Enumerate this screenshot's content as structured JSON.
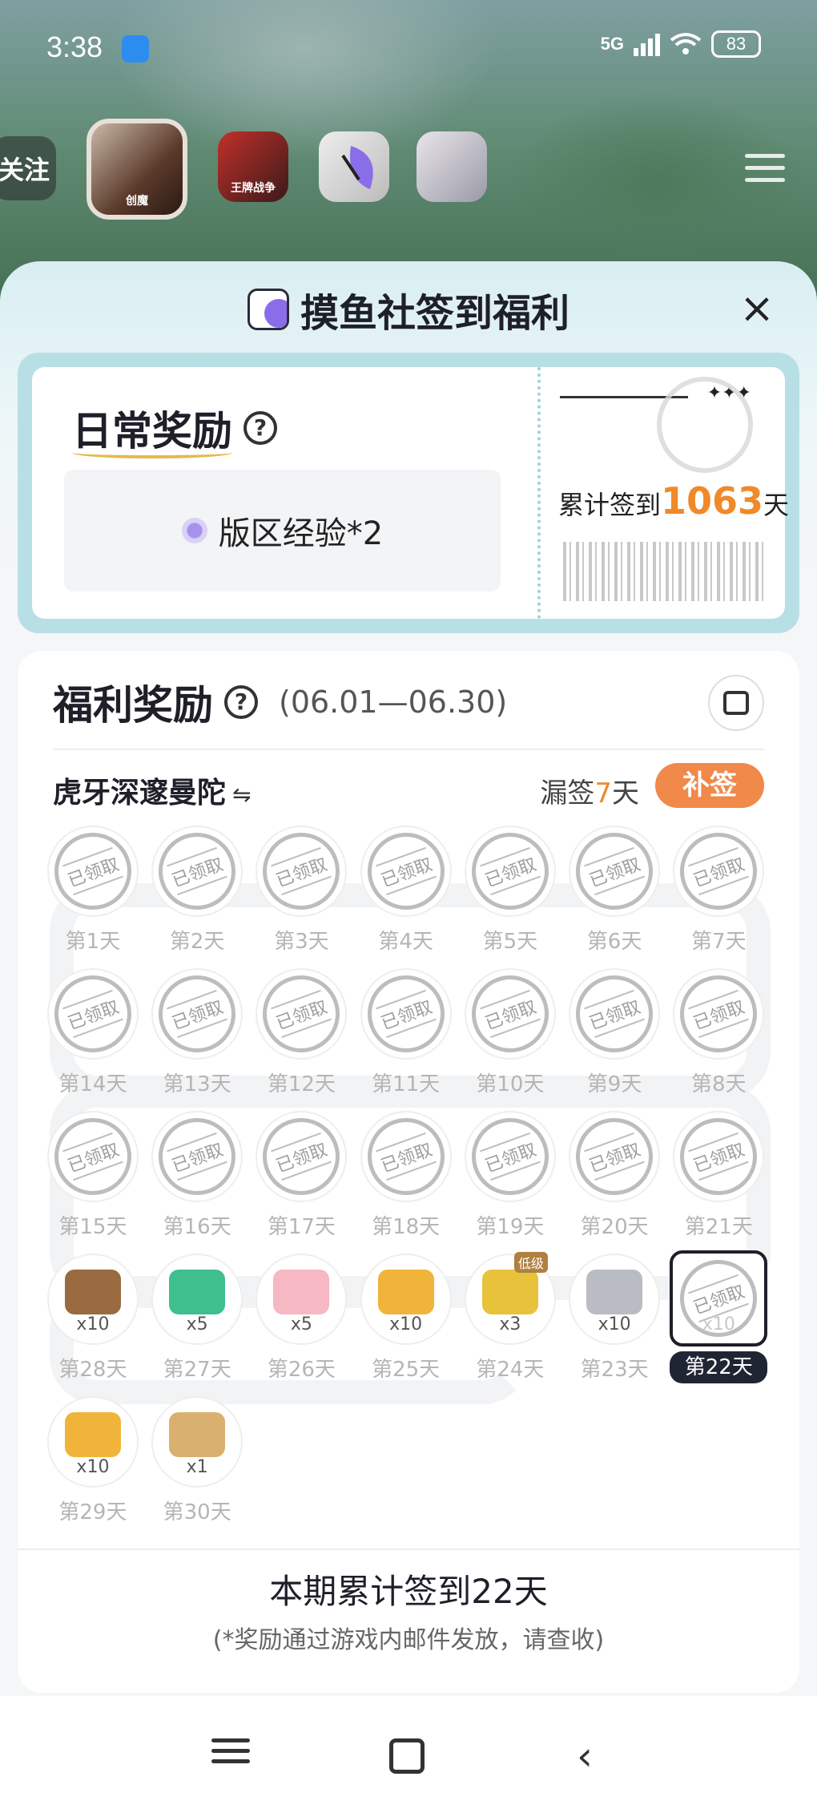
{
  "status": {
    "time": "3:38",
    "network": "5G",
    "battery": "83"
  },
  "topnav": {
    "follow_label": "关注",
    "tiles": [
      {
        "name": "创魔",
        "active": true
      },
      {
        "name": "王牌战争",
        "active": false
      },
      {
        "name": "摸鱼社",
        "active": false
      },
      {
        "name": "",
        "active": false
      }
    ]
  },
  "sheet": {
    "title": "摸鱼社签到福利",
    "close": "×"
  },
  "ticket": {
    "daily_title": "日常奖励",
    "daily_reward": "版区经验*2",
    "cumulative_prefix": "累计签到",
    "cumulative_days": "1063",
    "cumulative_suffix": "天",
    "stars": "✦✦✦"
  },
  "welfare": {
    "title": "福利奖励",
    "range": "(06.01—06.30)",
    "item_name": "虎牙深邃曼陀",
    "swap": "⇋",
    "missed_prefix": "漏签",
    "missed_days": "7",
    "missed_suffix": "天",
    "makeup_label": "补签",
    "claimed_text": "已领取",
    "days": [
      {
        "label": "第1天",
        "state": "claimed"
      },
      {
        "label": "第2天",
        "state": "claimed"
      },
      {
        "label": "第3天",
        "state": "claimed"
      },
      {
        "label": "第4天",
        "state": "claimed"
      },
      {
        "label": "第5天",
        "state": "claimed"
      },
      {
        "label": "第6天",
        "state": "claimed"
      },
      {
        "label": "第7天",
        "state": "claimed"
      },
      {
        "label": "第8天",
        "state": "claimed"
      },
      {
        "label": "第9天",
        "state": "claimed"
      },
      {
        "label": "第10天",
        "state": "claimed"
      },
      {
        "label": "第11天",
        "state": "claimed"
      },
      {
        "label": "第12天",
        "state": "claimed"
      },
      {
        "label": "第13天",
        "state": "claimed"
      },
      {
        "label": "第14天",
        "state": "claimed"
      },
      {
        "label": "第15天",
        "state": "claimed"
      },
      {
        "label": "第16天",
        "state": "claimed"
      },
      {
        "label": "第17天",
        "state": "claimed"
      },
      {
        "label": "第18天",
        "state": "claimed"
      },
      {
        "label": "第19天",
        "state": "claimed"
      },
      {
        "label": "第20天",
        "state": "claimed"
      },
      {
        "label": "第21天",
        "state": "claimed"
      },
      {
        "label": "第22天",
        "state": "current",
        "qty": "x10"
      },
      {
        "label": "第23天",
        "state": "pending",
        "qty": "x10",
        "color": "#b9bcc2"
      },
      {
        "label": "第24天",
        "state": "pending",
        "qty": "x3",
        "color": "#e8c23a",
        "tag": "低级"
      },
      {
        "label": "第25天",
        "state": "pending",
        "qty": "x10",
        "color": "#f0b43a"
      },
      {
        "label": "第26天",
        "state": "pending",
        "qty": "x5",
        "color": "#f6b8c2"
      },
      {
        "label": "第27天",
        "state": "pending",
        "qty": "x5",
        "color": "#3fbf8e"
      },
      {
        "label": "第28天",
        "state": "pending",
        "qty": "x10",
        "color": "#9a6a40"
      },
      {
        "label": "第29天",
        "state": "pending",
        "qty": "x10",
        "color": "#f0b43a"
      },
      {
        "label": "第30天",
        "state": "pending",
        "qty": "x1",
        "color": "#d9b070"
      }
    ],
    "summary": "本期累计签到22天",
    "note": "(*奖励通过游戏内邮件发放，请查收)"
  },
  "navbar": {
    "menu": "menu",
    "home": "home",
    "back": "‹"
  }
}
